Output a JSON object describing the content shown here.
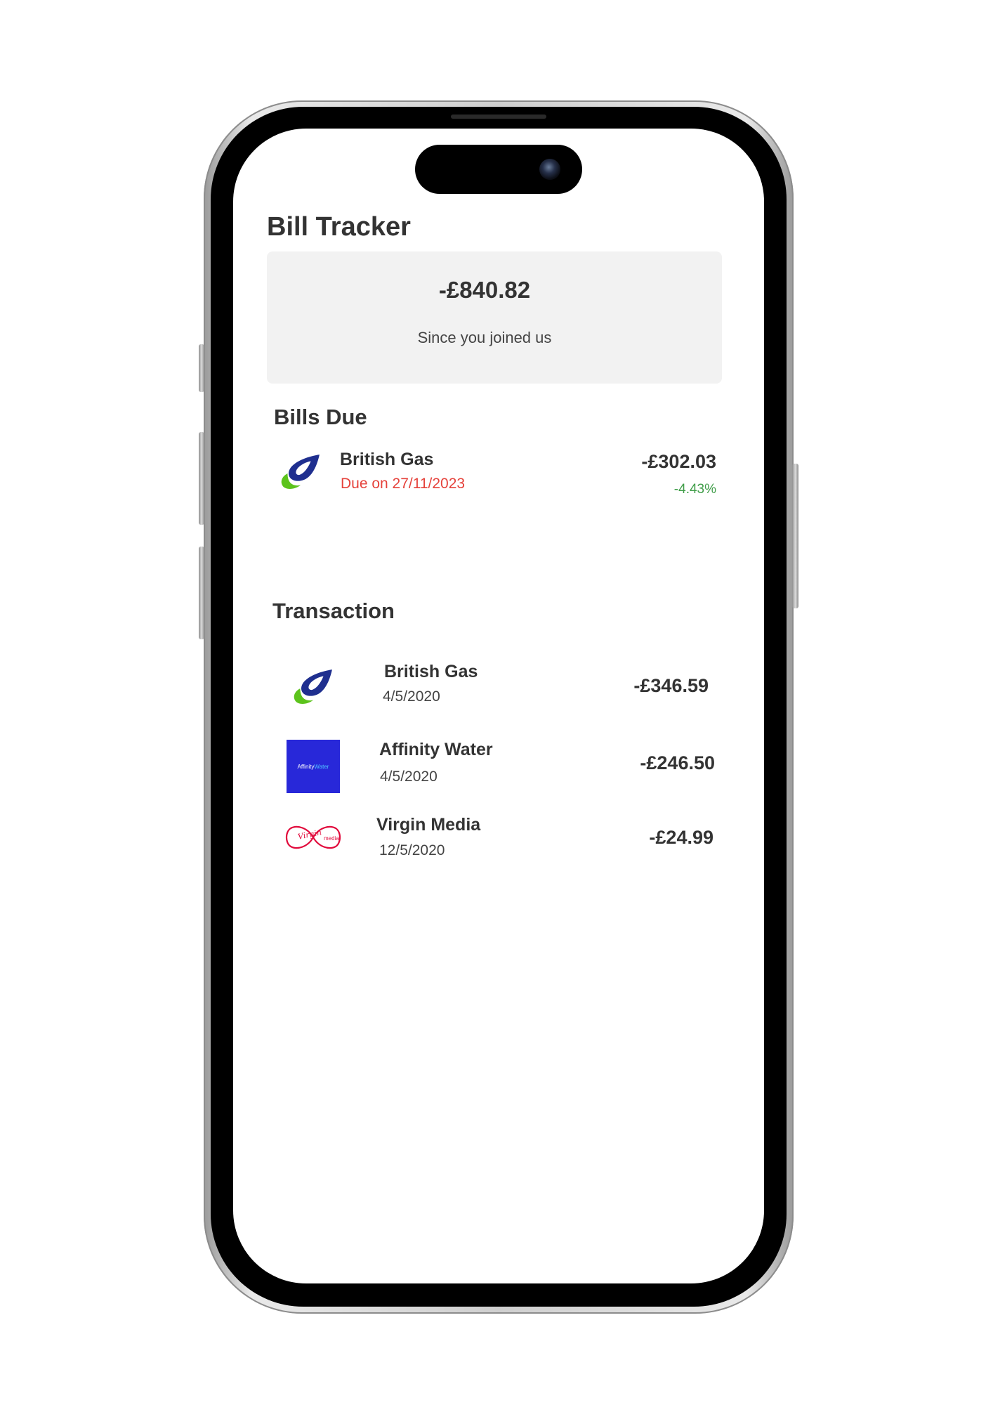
{
  "app": {
    "title": "Bill Tracker"
  },
  "summary": {
    "amount": "-£840.82",
    "caption": "Since you joined us"
  },
  "bills_due": {
    "heading": "Bills Due",
    "items": [
      {
        "name": "British Gas",
        "due_text": "Due on 27/11/2023",
        "amount": "-£302.03",
        "change": "-4.43%",
        "logo_icon": "british-gas-logo"
      }
    ]
  },
  "transactions": {
    "heading": "Transaction",
    "items": [
      {
        "name": "British Gas",
        "date": "4/5/2020",
        "amount": "-£346.59",
        "logo_icon": "british-gas-logo"
      },
      {
        "name": "Affinity Water",
        "date": "4/5/2020",
        "amount": "-£246.50",
        "logo_icon": "affinity-water-logo"
      },
      {
        "name": "Virgin Media",
        "date": "12/5/2020",
        "amount": "-£24.99",
        "logo_icon": "virgin-media-logo"
      }
    ]
  },
  "logos": {
    "affinity_water_word1": "Affinity",
    "affinity_water_word2": "Water",
    "virgin_word": "Virgin",
    "media_word": "media"
  },
  "colors": {
    "due_date": "#e5423b",
    "positive_change": "#3f9d48",
    "card_background": "#f2f2f2",
    "british_gas_blue": "#1f2f8f",
    "british_gas_green": "#5cc31c",
    "affinity_blue": "#2828d9",
    "virgin_red": "#e10a3c"
  }
}
